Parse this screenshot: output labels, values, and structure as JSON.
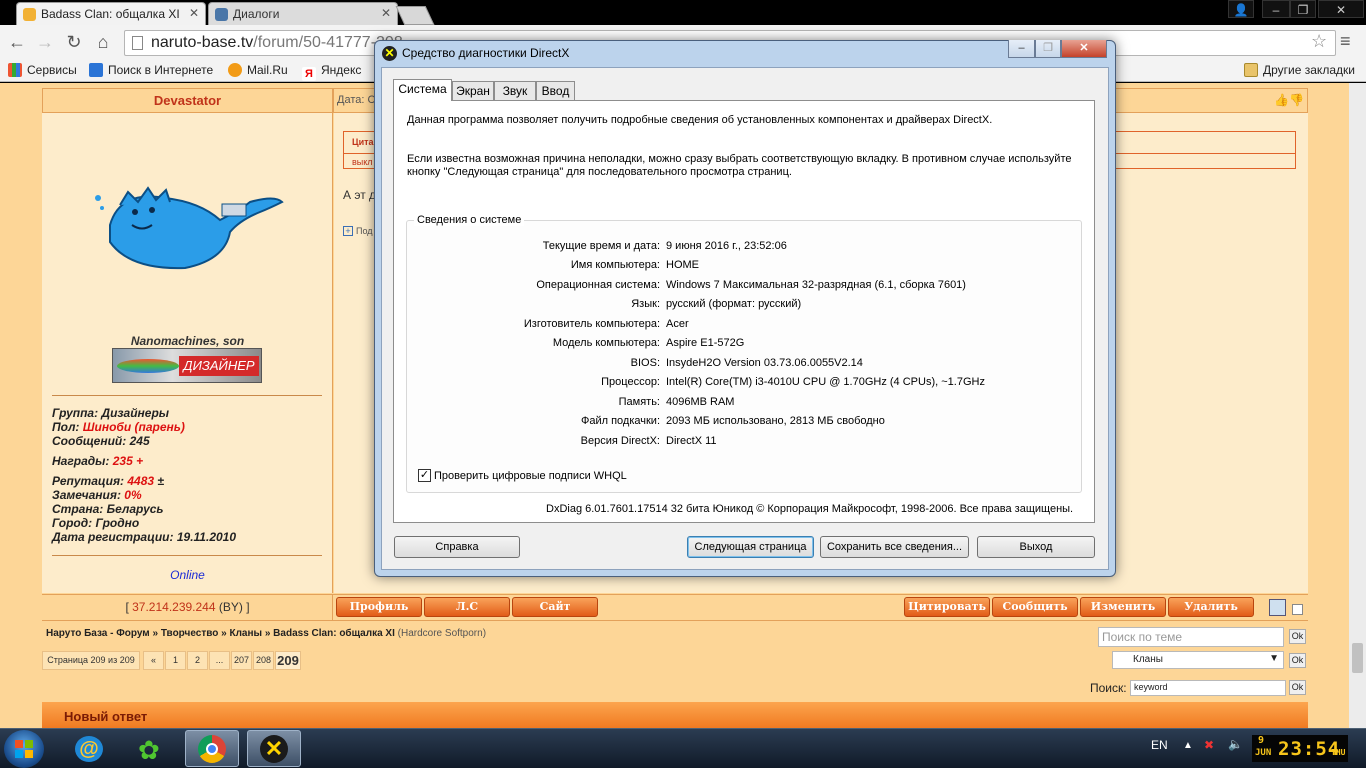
{
  "browser": {
    "tabs": [
      {
        "title": "Badass Clan: общалка XI",
        "active": true
      },
      {
        "title": "Диалоги",
        "active": false
      }
    ],
    "url_host": "naruto-base.tv",
    "url_path": "/forum/50-41777-208",
    "bookmarks": [
      "Сервисы",
      "Поиск в Интернете",
      "Mail.Ru",
      "Яндекс"
    ],
    "other_bookmarks": "Другие закладки"
  },
  "forum": {
    "author": "Devastator",
    "post_date_label": "Дата: С",
    "quote_label": "Цита",
    "quote_text": "выкл",
    "post_text": "А эт д",
    "expand_label": "Под",
    "user_title": "Nanomachines, son",
    "userbar_text": "ДИЗАЙНЕР",
    "group": "Группа: Дизайнеры",
    "gender_label": "Пол: ",
    "gender_value": "Шиноби (парень)",
    "messages": "Сообщений: 245",
    "awards_label": "Награды: ",
    "awards_value": "235",
    "awards_plus": "+",
    "reputation_label": "Репутация: ",
    "reputation_value": "4483",
    "reputation_pm": "±",
    "warnings_label": "Замечания: ",
    "warnings_value": "0%",
    "country": "Страна: Беларусь",
    "city": "Город: Гродно",
    "registered": "Дата регистрации: 19.11.2010",
    "online": "Online",
    "ip_open": "[ ",
    "ip": "37.214.239.244",
    "ip_country": " (BY)",
    "ip_close": " ]",
    "left_buttons": [
      "Профиль",
      "Л.С",
      "Сайт"
    ],
    "right_buttons": [
      "Цитировать",
      "Сообщить",
      "Изменить",
      "Удалить"
    ],
    "breadcrumb": "Наруто База - Форум » Творчество » Кланы » Badass Clan: общалка XI",
    "breadcrumb_suffix": "(Hardcore Softporn)",
    "pages_label": "Страница 209 из 209",
    "pages": [
      "«",
      "1",
      "2",
      "...",
      "207",
      "208"
    ],
    "current_page": "209",
    "theme_search_placeholder": "Поиск по теме",
    "ok": "Ok",
    "category_select": "Кланы",
    "search_label": "Поиск:",
    "search_value": "keyword",
    "new_reply": "Новый ответ"
  },
  "dxdiag": {
    "title": "Средство диагностики DirectX",
    "tabs": [
      "Система",
      "Экран",
      "Звук",
      "Ввод"
    ],
    "intro1": "Данная программа позволяет получить подробные сведения об установленных компонентах и драйверах DirectX.",
    "intro2": "Если известна возможная причина неполадки, можно сразу выбрать соответствующую вкладку. В противном случае используйте кнопку \"Следующая страница\" для последовательного просмотра страниц.",
    "group_label": "Сведения о системе",
    "rows": [
      {
        "label": "Текущие время и дата:",
        "value": "9 июня 2016 г., 23:52:06"
      },
      {
        "label": "Имя компьютера:",
        "value": "HOME"
      },
      {
        "label": "Операционная система:",
        "value": "Windows 7 Максимальная 32-разрядная (6.1, сборка 7601)"
      },
      {
        "label": "Язык:",
        "value": "русский (формат: русский)"
      },
      {
        "label": "Изготовитель компьютера:",
        "value": "Acer"
      },
      {
        "label": "Модель компьютера:",
        "value": "Aspire E1-572G"
      },
      {
        "label": "BIOS:",
        "value": "InsydeH2O Version 03.73.06.0055V2.14"
      },
      {
        "label": "Процессор:",
        "value": "Intel(R) Core(TM) i3-4010U CPU @ 1.70GHz (4 CPUs), ~1.7GHz"
      },
      {
        "label": "Память:",
        "value": "4096MB RAM"
      },
      {
        "label": "Файл подкачки:",
        "value": "2093 МБ использовано, 2813 МБ свободно"
      },
      {
        "label": "Версия DirectX:",
        "value": "DirectX 11"
      }
    ],
    "whql_label": "Проверить цифровые подписи WHQL",
    "whql_checked": true,
    "footer": "DxDiag 6.01.7601.17514 32 бита Юникод  © Корпорация Майкрософт, 1998-2006.  Все права защищены.",
    "buttons": {
      "help": "Справка",
      "next": "Следующая страница",
      "save": "Сохранить все сведения...",
      "exit": "Выход"
    }
  },
  "taskbar": {
    "language": "EN",
    "clock_time": "23:54",
    "clock_month": "JUN",
    "clock_day": "9",
    "clock_weekday": "THU"
  }
}
